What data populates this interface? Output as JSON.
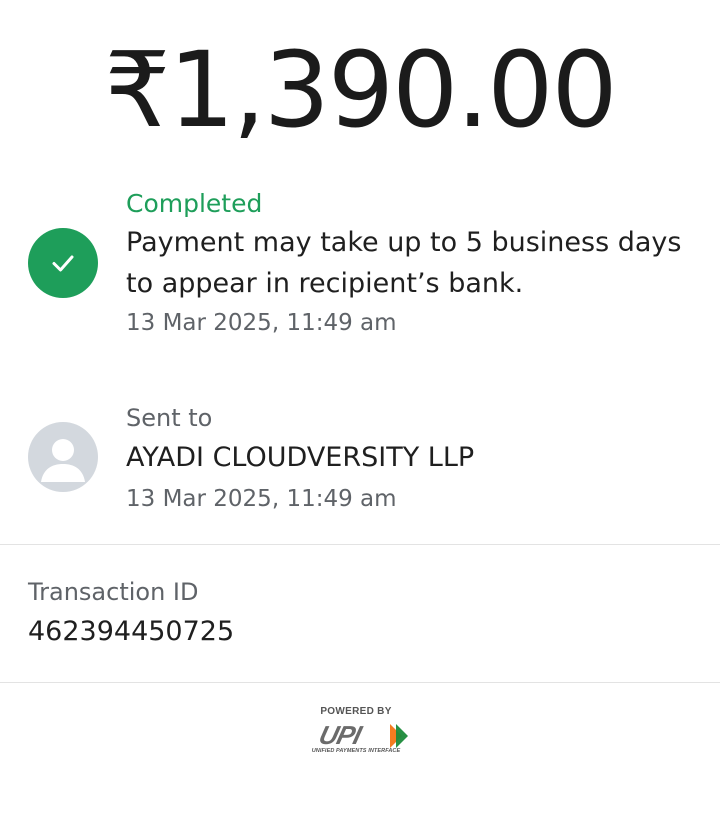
{
  "payment": {
    "amount": "₹1,390.00"
  },
  "status": {
    "label": "Completed",
    "message": "Payment may take up to 5 business days to appear in recipient’s bank.",
    "date": "13 Mar 2025, 11:49 am",
    "color": "#1e9e5a",
    "icon": "check-icon"
  },
  "recipient": {
    "label": "Sent to",
    "name": "AYADI CLOUDVERSITY LLP",
    "date": "13 Mar 2025, 11:49 am",
    "icon": "avatar-person-icon"
  },
  "transaction": {
    "label": "Transaction ID",
    "id": "462394450725"
  },
  "footer": {
    "powered_by": "POWERED BY",
    "brand": "UPI",
    "brand_subtitle": "UNIFIED PAYMENTS INTERFACE"
  }
}
